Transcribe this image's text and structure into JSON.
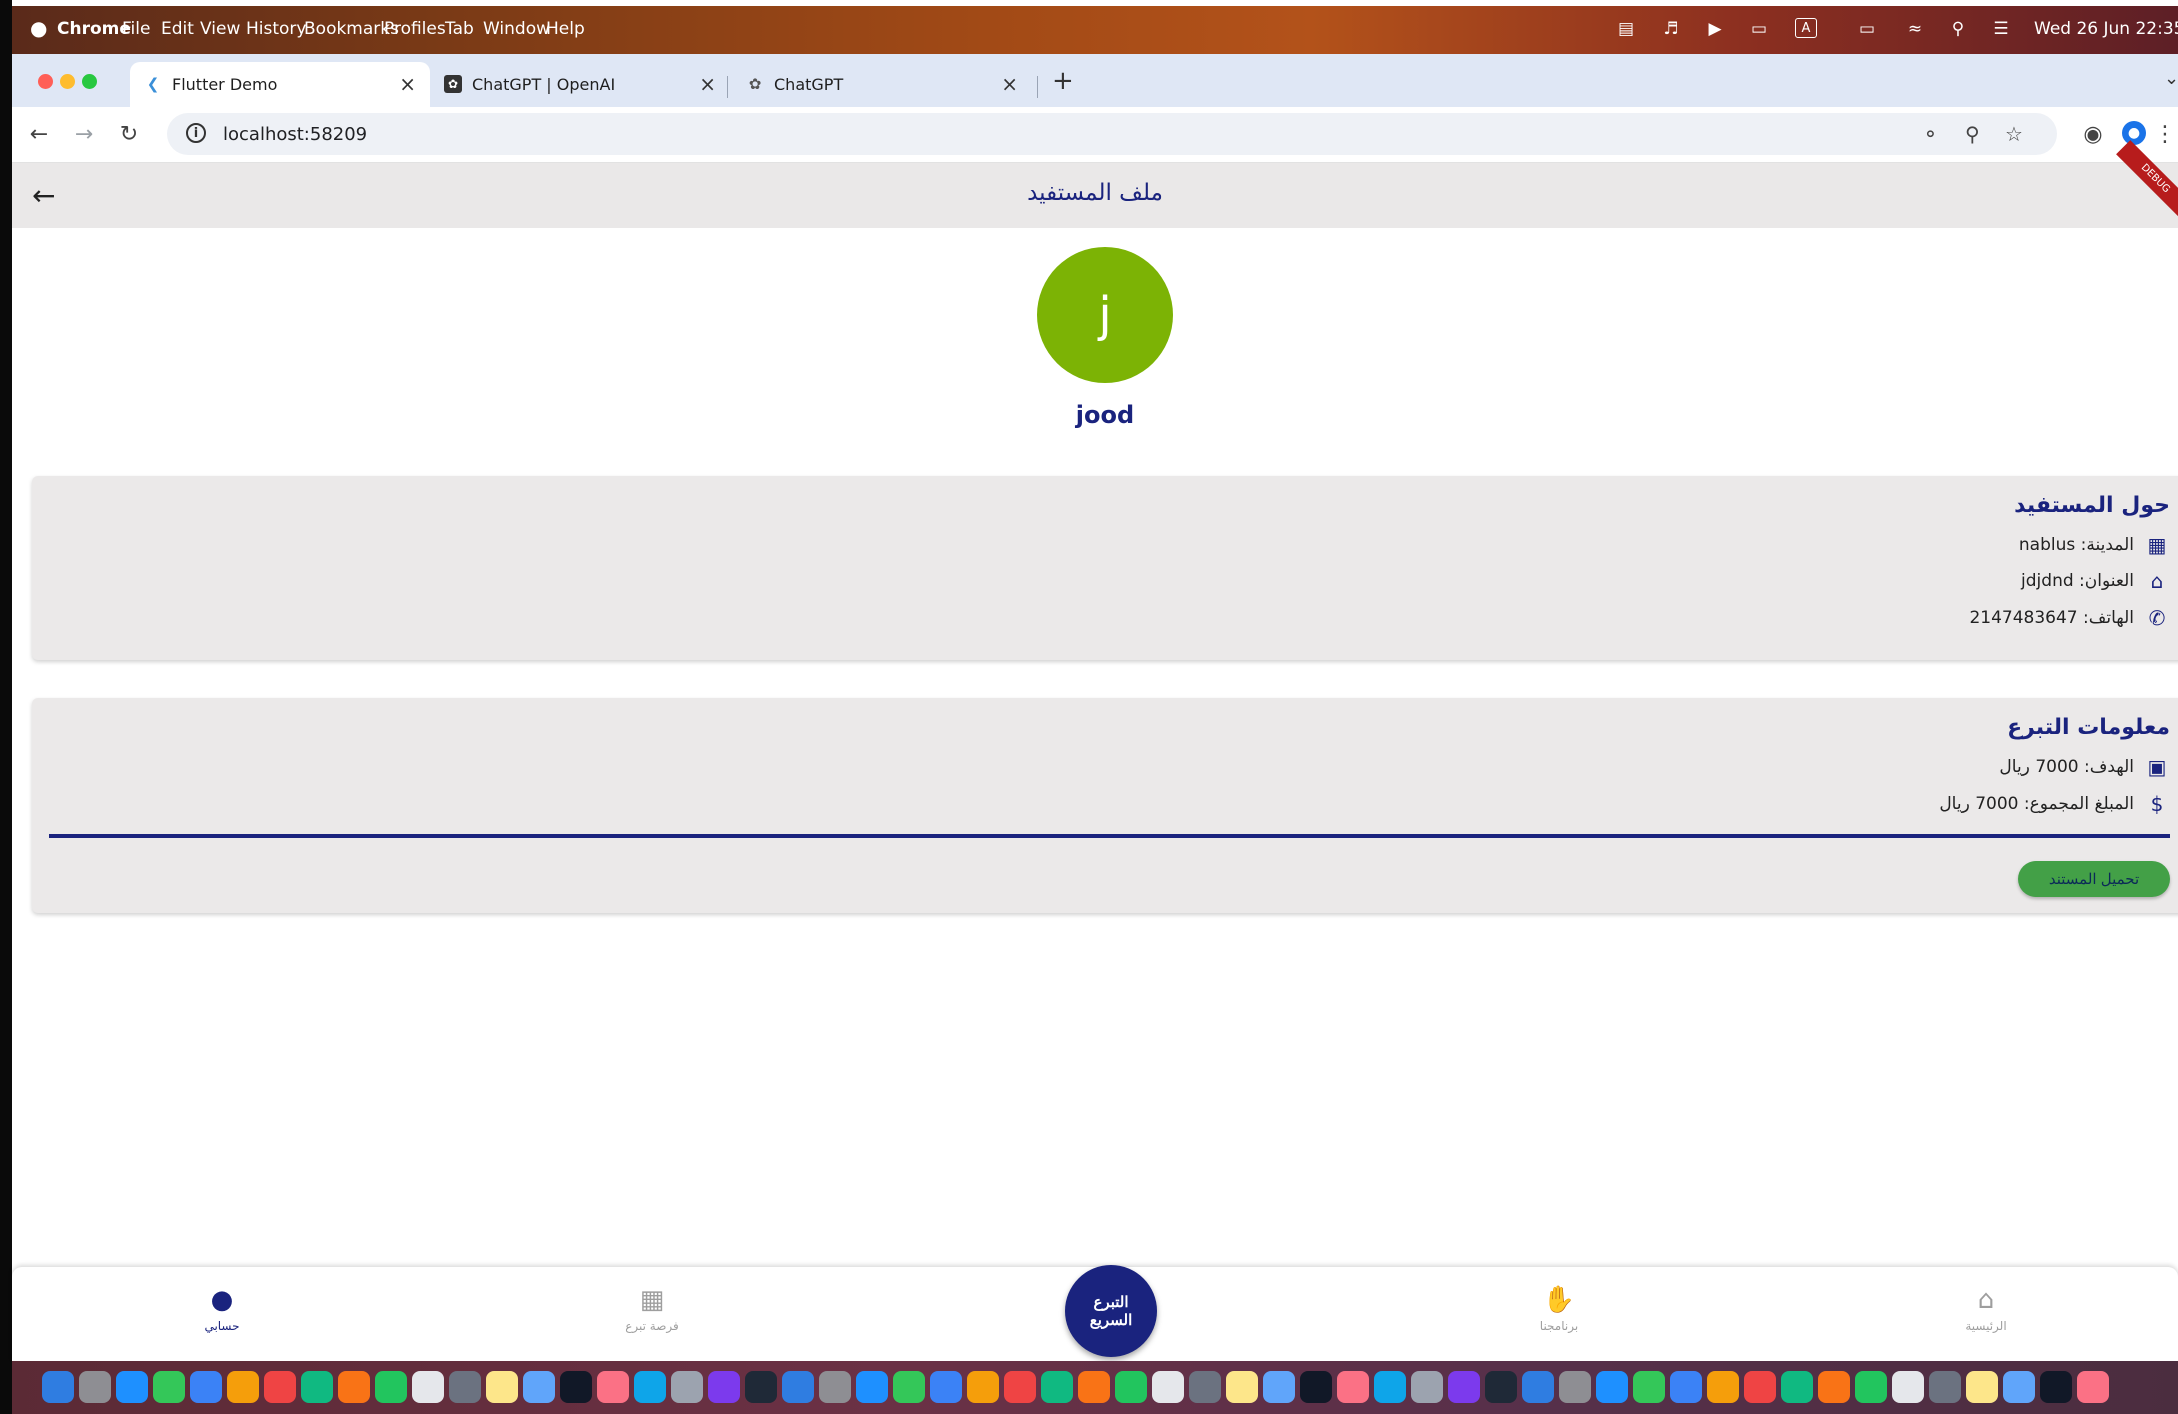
{
  "menubar": {
    "apple": "",
    "app_name": "Chrome",
    "menus": [
      "File",
      "Edit",
      "View",
      "History",
      "Bookmarks",
      "Profiles",
      "Tab",
      "Window",
      "Help"
    ],
    "datetime": "Wed 26 Jun 22:35"
  },
  "tabs": [
    {
      "title": "Flutter Demo",
      "active": true
    },
    {
      "title": "ChatGPT | OpenAI",
      "active": false
    },
    {
      "title": "ChatGPT",
      "active": false
    }
  ],
  "toolbar": {
    "url": "localhost:58209"
  },
  "app": {
    "title": "ملف المستفيد",
    "debug_ribbon": "DEBUG",
    "avatar_letter": "j",
    "username": "jood",
    "about": {
      "title": "حول المستفيد",
      "city": "المدينة: nablus",
      "address": "العنوان: jdjdnd",
      "phone": "الهاتف: 2147483647"
    },
    "donation": {
      "title": "معلومات التبرع",
      "goal": "الهدف: 7000 ريال",
      "collected": "المبلغ المجموع: 7000 ريال",
      "progress": 1.0,
      "upload_button": "تحميل المستند"
    },
    "bottom_nav": {
      "account": "حسابي",
      "opportunity": "فرصة تبرع",
      "quick_donate": "التبرع السريع",
      "programs": "برنامجنا",
      "home": "الرئيسية"
    }
  },
  "colors": {
    "accent": "#1a237e",
    "avatar": "#7cb305",
    "button": "#43a047",
    "appbar": "#eae8e8"
  }
}
